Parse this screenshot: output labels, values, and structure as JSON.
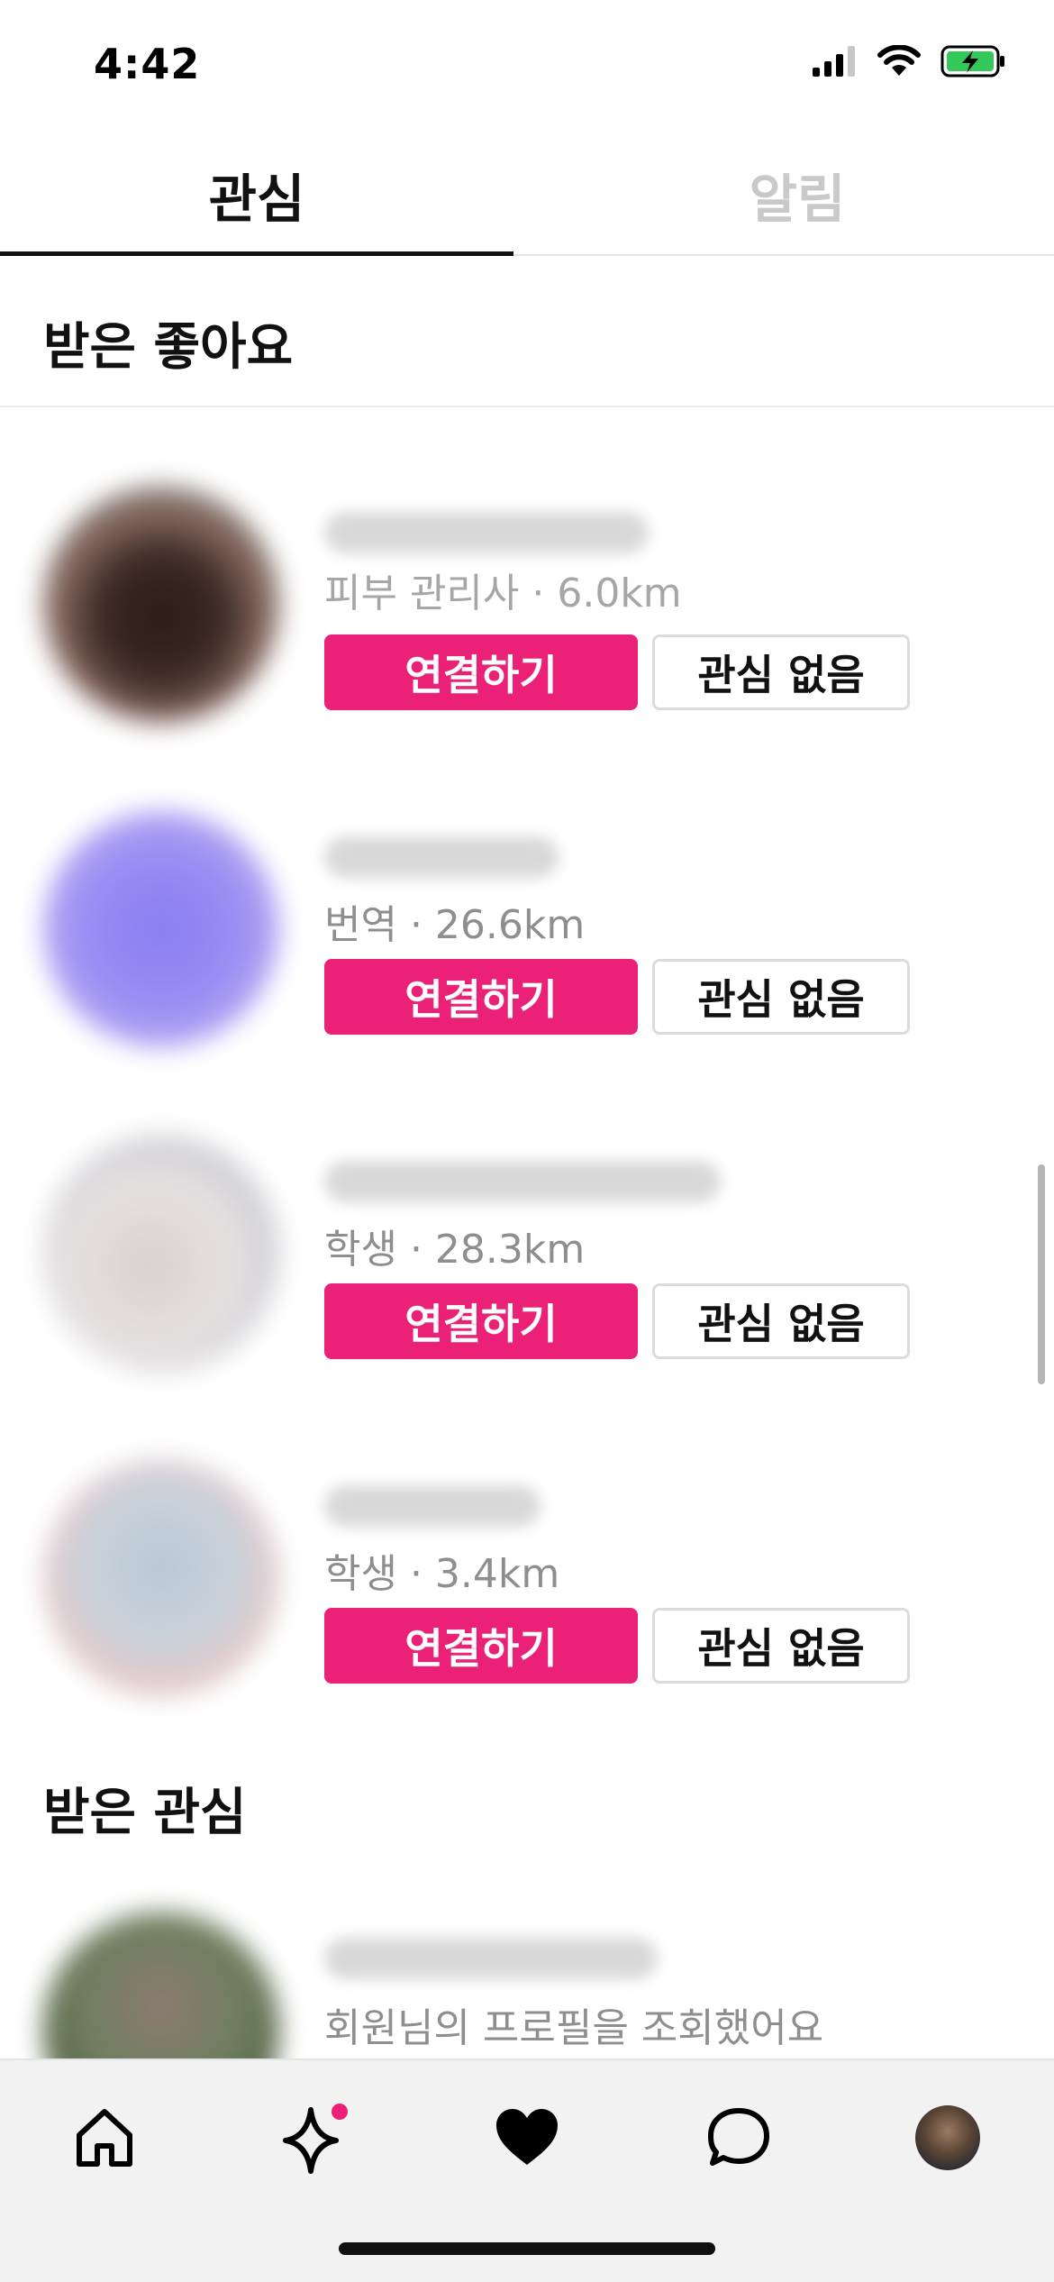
{
  "status_bar": {
    "time": "4:42"
  },
  "tabs": [
    {
      "label": "관심",
      "active": true
    },
    {
      "label": "알림",
      "active": false
    }
  ],
  "sections": {
    "likes_title": "받은 좋아요",
    "interest_title": "받은 관심"
  },
  "cards": [
    {
      "meta": "피부 관리사 · 6.0km",
      "connect_label": "연결하기",
      "pass_label": "관심 없음"
    },
    {
      "meta": "번역 · 26.6km",
      "connect_label": "연결하기",
      "pass_label": "관심 없음"
    },
    {
      "meta": "학생 · 28.3km",
      "connect_label": "연결하기",
      "pass_label": "관심 없음"
    },
    {
      "meta": "학생 · 3.4km",
      "connect_label": "연결하기",
      "pass_label": "관심 없음"
    }
  ],
  "interest_item": {
    "meta": "회원님의 프로필을 조회했어요"
  },
  "colors": {
    "accent": "#ea2176",
    "tab_active": "#111111",
    "tab_inactive": "#c9c9c9",
    "meta_text": "#8e8e8e",
    "battery": "#34c759",
    "nav_bg": "#f2f2f2"
  },
  "nav": [
    {
      "icon": "home-icon"
    },
    {
      "icon": "sparkle-icon",
      "badge": true
    },
    {
      "icon": "heart-icon",
      "active": true
    },
    {
      "icon": "chat-bubble-icon"
    },
    {
      "icon": "profile-avatar"
    }
  ]
}
